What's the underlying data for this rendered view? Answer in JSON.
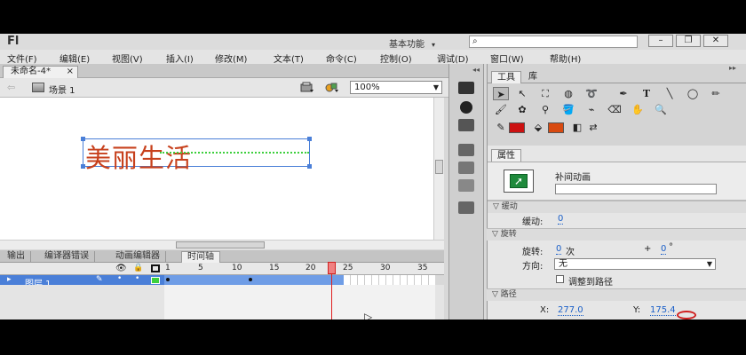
{
  "app": {
    "logo": "Fl",
    "workspace": "基本功能",
    "search_placeholder": "⌕",
    "win_minimize": "–",
    "win_restore": "❐",
    "win_close": "✕"
  },
  "menu": [
    "文件(F)",
    "编辑(E)",
    "视图(V)",
    "插入(I)",
    "修改(M)",
    "文本(T)",
    "命令(C)",
    "控制(O)",
    "调试(D)",
    "窗口(W)",
    "帮助(H)"
  ],
  "document": {
    "tab_title": "未命名-4*",
    "tab_close": "×"
  },
  "editbar": {
    "scene": "场景 1",
    "zoom": "100%"
  },
  "stage": {
    "text_object": "美丽生活"
  },
  "bottom_tabs": [
    "输出",
    "编译器错误",
    "动画编辑器",
    "时间轴"
  ],
  "timeline": {
    "frame_numbers": [
      "1",
      "5",
      "10",
      "15",
      "20",
      "25",
      "30",
      "35"
    ],
    "current_frame": 24,
    "layer_name": "图层 1"
  },
  "tools_panel": {
    "tabs": [
      "工具",
      "库"
    ]
  },
  "colors": {
    "stroke": "#cc1111",
    "fill": "#d84a10",
    "text_color": "#c7401c",
    "selection": "#4a7fd8",
    "motion_path": "#3dcf3d",
    "playhead": "#e02020"
  },
  "properties": {
    "tab": "属性",
    "tween_type": "补间动画",
    "sections": {
      "ease": "缓动",
      "rotate": "旋转",
      "path": "路径"
    },
    "ease_label": "缓动:",
    "ease_value": "0",
    "rotate_label": "旋转:",
    "rotate_times": "0",
    "rotate_times_unit": "次",
    "rotate_plus": "+",
    "rotate_degrees": "0",
    "rotate_degree_unit": "°",
    "direction_label": "方向:",
    "direction_value": "无",
    "orient_to_path": "调整到路径",
    "x_label": "X:",
    "x_value": "277.0",
    "y_label": "Y:",
    "y_value": "175.4"
  }
}
